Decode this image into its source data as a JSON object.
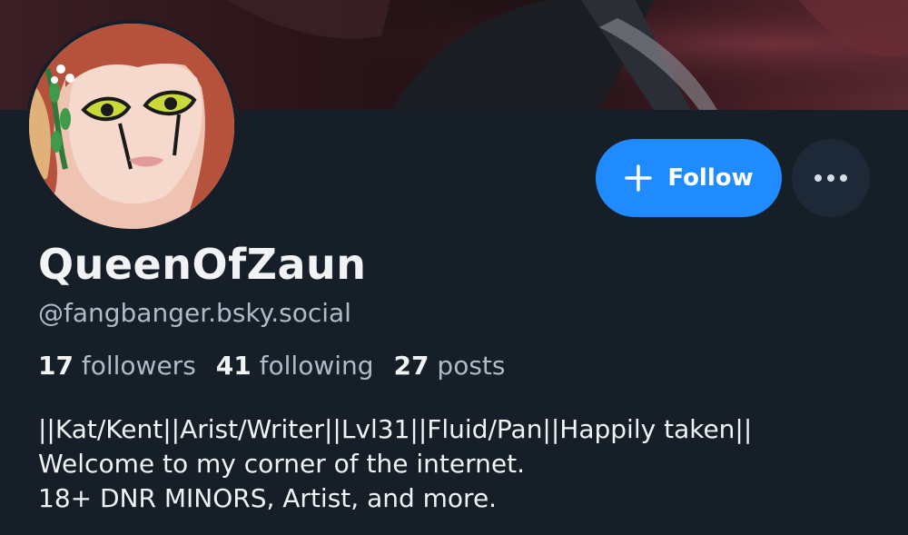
{
  "profile": {
    "display_name": "QueenOfZaun",
    "handle": "@fangbanger.bsky.social",
    "stats": {
      "followers_count": "17",
      "followers_label": "followers",
      "following_count": "41",
      "following_label": "following",
      "posts_count": "27",
      "posts_label": "posts"
    },
    "bio": {
      "line1": "||Kat/Kent||Arist/Writer||Lvl31||Fluid/Pan||Happily taken||",
      "line2": "Welcome to my corner of the internet.",
      "line3": "18+ DNR MINORS, Artist, and more."
    }
  },
  "actions": {
    "follow_label": "Follow",
    "follow_icon": "plus-icon",
    "more_icon": "ellipsis-icon"
  },
  "colors": {
    "background": "#161e27",
    "accent": "#208bfe",
    "secondary_text": "#aebbc9",
    "primary_text": "#f1f3f5"
  }
}
